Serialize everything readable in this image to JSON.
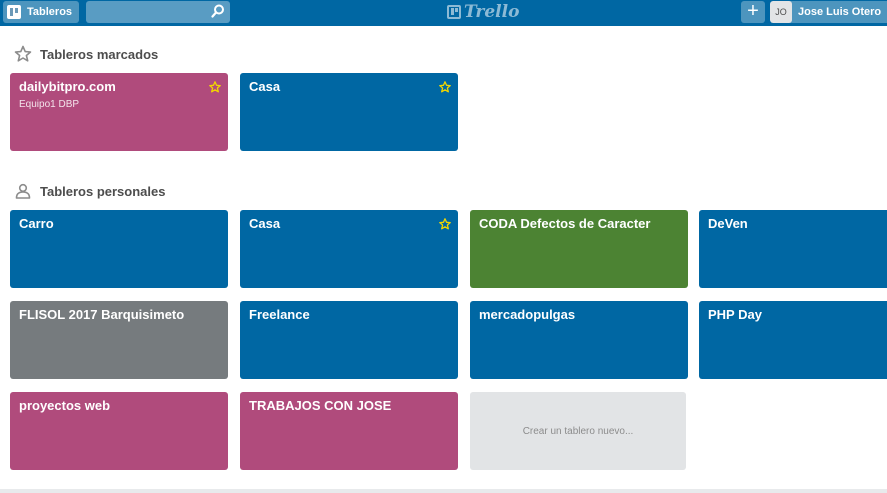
{
  "header": {
    "boards_label": "Tableros",
    "search_value": "",
    "logo_text": "Trello",
    "add_label": "+",
    "user_initials": "JO",
    "user_name": "Jose Luis Otero"
  },
  "starred": {
    "title": "Tableros marcados",
    "boards": [
      {
        "name": "dailybitpro.com",
        "team": "Equipo1 DBP",
        "color": "#b04b7c",
        "starred": true
      },
      {
        "name": "Casa",
        "team": "",
        "color": "#0067a3",
        "starred": true
      }
    ]
  },
  "personal": {
    "title": "Tableros personales",
    "boards": [
      {
        "name": "Carro",
        "color": "#0067a3",
        "starred": false
      },
      {
        "name": "Casa",
        "color": "#0067a3",
        "starred": true
      },
      {
        "name": "CODA Defectos de Caracter",
        "color": "#4c8333",
        "starred": false
      },
      {
        "name": "DeVen",
        "color": "#0067a3",
        "starred": false
      },
      {
        "name": "FLISOL 2017 Barquisimeto",
        "color": "#767b7e",
        "starred": false
      },
      {
        "name": "Freelance",
        "color": "#0067a3",
        "starred": false
      },
      {
        "name": "mercadopulgas",
        "color": "#0067a3",
        "starred": false
      },
      {
        "name": "PHP Day",
        "color": "#0067a3",
        "starred": false
      },
      {
        "name": "proyectos web",
        "color": "#b04b7c",
        "starred": false
      },
      {
        "name": "TRABAJOS CON JOSE",
        "color": "#b04b7c",
        "starred": false
      }
    ],
    "create_label": "Crear un tablero nuevo..."
  },
  "colors": {
    "header_bg": "#0067a3",
    "star": "#f2d600"
  }
}
